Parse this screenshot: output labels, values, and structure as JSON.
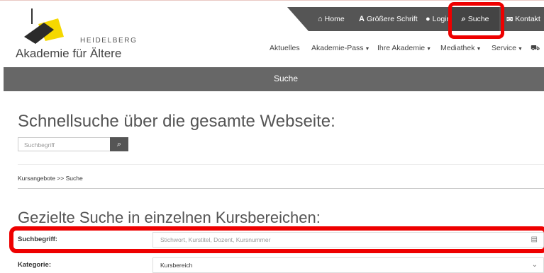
{
  "logo": {
    "city": "HEIDELBERG",
    "name": "Akademie für Ältere"
  },
  "topnav": {
    "home": "Home",
    "font": "Größere Schrift",
    "login": "Login",
    "search": "Suche",
    "contact": "Kontakt"
  },
  "mainnav": {
    "news": "Aktuelles",
    "pass": "Akademie-Pass",
    "academy": "Ihre Akademie",
    "media": "Mediathek",
    "service": "Service"
  },
  "page_title": "Suche",
  "quick_search": {
    "heading": "Schnellsuche über die gesamte Webseite:",
    "placeholder": "Suchbegriff"
  },
  "breadcrumb": "Kursangebote >> Suche",
  "course_search": {
    "heading": "Gezielte Suche in einzelnen Kursbereichen:",
    "term_label": "Suchbegriff:",
    "term_placeholder": "Stichwort, Kurstitel, Dozent, Kursnummer",
    "category_label": "Kategorie:",
    "category_value": "Kursbereich"
  },
  "colors": {
    "dark_bar": "#555555",
    "page_bar": "#676767",
    "highlight": "#ee0000",
    "logo_yellow": "#f5d800"
  }
}
